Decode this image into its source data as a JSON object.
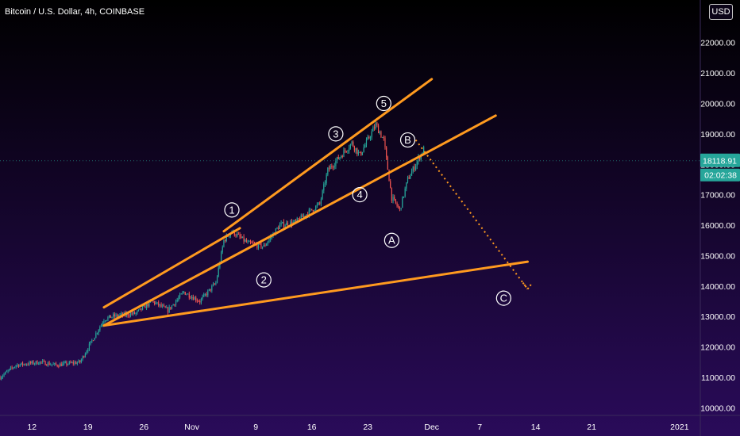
{
  "header": {
    "title": "Bitcoin / U.S. Dollar, 4h, COINBASE"
  },
  "currency_button": "USD",
  "price_badges": {
    "last_price": "18118.91",
    "countdown": "02:02:38"
  },
  "colors": {
    "bg_top": "#000000",
    "bg_bottom": "#2a0b5a",
    "up": "#26a69a",
    "down": "#ef5350",
    "trend": "#ff9a1f",
    "label": "#ffffff",
    "badge": "#26a69a"
  },
  "chart_data": {
    "type": "candlestick",
    "symbol": "Bitcoin / U.S. Dollar, 4h, COINBASE",
    "y_ticks": [
      10000,
      11000,
      12000,
      13000,
      14000,
      15000,
      16000,
      17000,
      18000,
      19000,
      20000,
      21000,
      22000
    ],
    "y_tick_labels": [
      "10000.00",
      "11000.00",
      "12000.00",
      "13000.00",
      "14000.00",
      "15000.00",
      "16000.00",
      "17000.00",
      "18000.00",
      "19000.00",
      "20000.00",
      "21000.00",
      "22000.00"
    ],
    "x_ticks": [
      "2020-10-12",
      "2020-10-19",
      "2020-10-26",
      "2020-11-01",
      "2020-11-09",
      "2020-11-16",
      "2020-11-23",
      "2020-12-01",
      "2020-12-07",
      "2020-12-14",
      "2020-12-21",
      "2021-01-01"
    ],
    "x_tick_labels": [
      "12",
      "19",
      "26",
      "Nov",
      "9",
      "16",
      "23",
      "Dec",
      "7",
      "14",
      "21",
      "2021"
    ],
    "x_range": [
      "2020-10-08",
      "2021-01-03"
    ],
    "y_range": [
      9800,
      23400
    ],
    "close_path": [
      [
        "2020-10-08",
        11000
      ],
      [
        "2020-10-10",
        11400
      ],
      [
        "2020-10-13",
        11500
      ],
      [
        "2020-10-15",
        11400
      ],
      [
        "2020-10-18",
        11500
      ],
      [
        "2020-10-21",
        12900
      ],
      [
        "2020-10-22",
        13000
      ],
      [
        "2020-10-25",
        13100
      ],
      [
        "2020-10-27",
        13500
      ],
      [
        "2020-10-29",
        13200
      ],
      [
        "2020-10-31",
        13800
      ],
      [
        "2020-11-02",
        13500
      ],
      [
        "2020-11-04",
        14100
      ],
      [
        "2020-11-05",
        15500
      ],
      [
        "2020-11-06",
        15800
      ],
      [
        "2020-11-08",
        15400
      ],
      [
        "2020-11-10",
        15300
      ],
      [
        "2020-11-12",
        16000
      ],
      [
        "2020-11-14",
        16100
      ],
      [
        "2020-11-17",
        16700
      ],
      [
        "2020-11-18",
        17800
      ],
      [
        "2020-11-21",
        18700
      ],
      [
        "2020-11-22",
        18300
      ],
      [
        "2020-11-24",
        19300
      ],
      [
        "2020-11-25",
        18800
      ],
      [
        "2020-11-26",
        16900
      ],
      [
        "2020-11-27",
        16500
      ],
      [
        "2020-11-28",
        17500
      ],
      [
        "2020-11-30",
        18500
      ]
    ],
    "trendlines": [
      {
        "name": "upper-channel",
        "from": [
          "2020-11-05",
          15800
        ],
        "to": [
          "2020-12-01",
          20800
        ]
      },
      {
        "name": "lower-channel",
        "from": [
          "2020-10-21",
          12700
        ],
        "to": [
          "2020-12-09",
          19600
        ]
      },
      {
        "name": "upper-left",
        "from": [
          "2020-10-21",
          13300
        ],
        "to": [
          "2020-11-07",
          15900
        ]
      },
      {
        "name": "base-line",
        "from": [
          "2020-10-21",
          12700
        ],
        "to": [
          "2020-12-13",
          14800
        ]
      }
    ],
    "projection": {
      "from": [
        "2020-11-29",
        18800
      ],
      "to": [
        "2020-12-13",
        13900
      ]
    },
    "wave_labels": [
      {
        "text": "1",
        "x": "2020-11-06",
        "y": 16500
      },
      {
        "text": "2",
        "x": "2020-11-10",
        "y": 14200
      },
      {
        "text": "3",
        "x": "2020-11-19",
        "y": 19000
      },
      {
        "text": "4",
        "x": "2020-11-22",
        "y": 17000
      },
      {
        "text": "5",
        "x": "2020-11-25",
        "y": 20000
      },
      {
        "text": "A",
        "x": "2020-11-26",
        "y": 15500
      },
      {
        "text": "B",
        "x": "2020-11-28",
        "y": 18800
      },
      {
        "text": "C",
        "x": "2020-12-10",
        "y": 13600
      }
    ],
    "last_price": 18118.91
  }
}
